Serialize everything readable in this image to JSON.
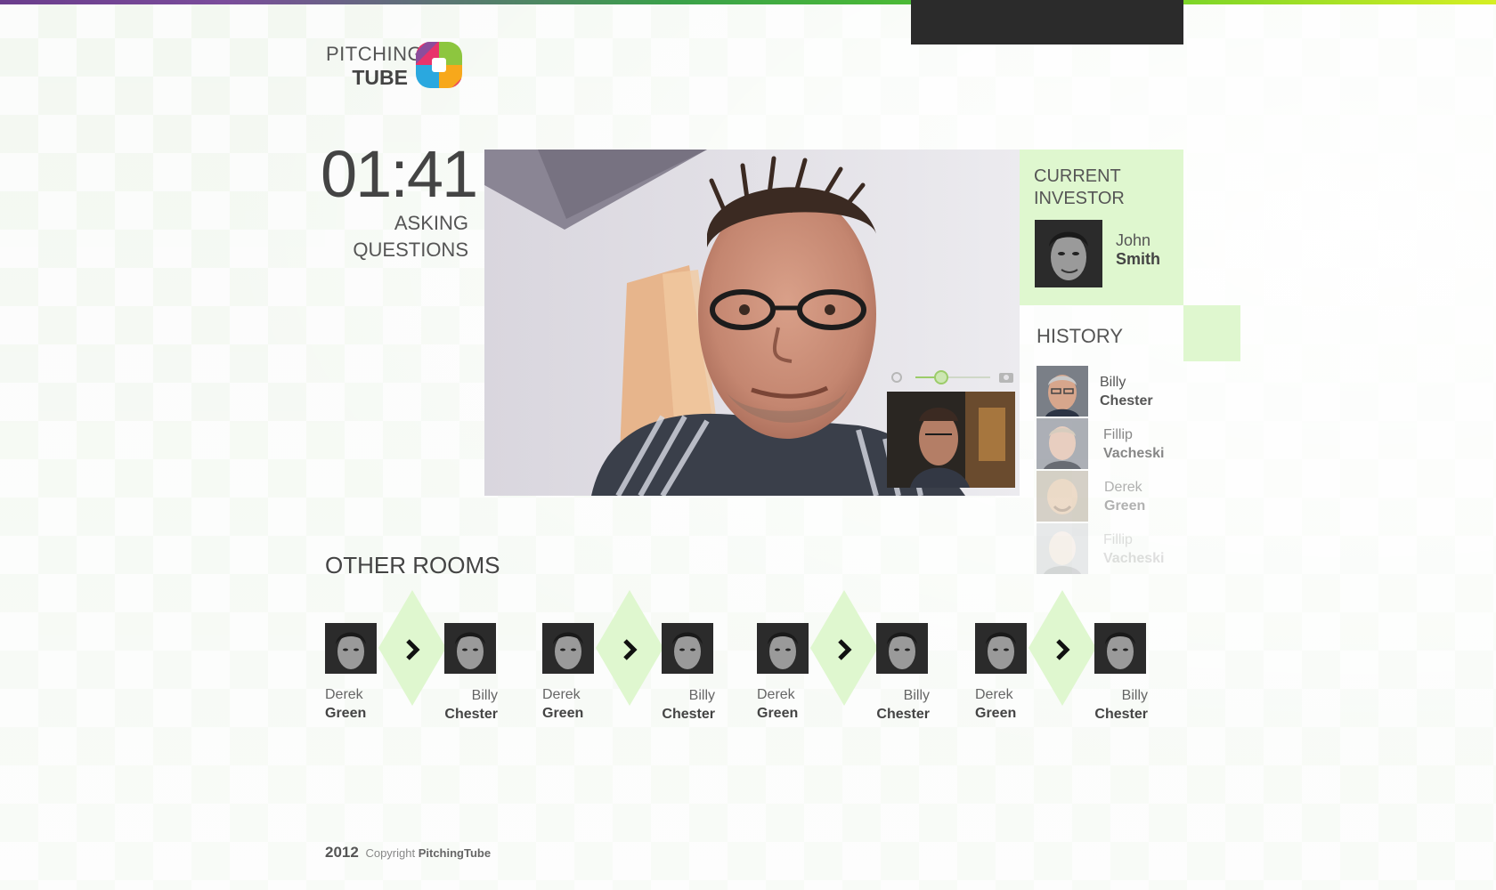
{
  "brand": {
    "logo_line1": "PITCHING",
    "logo_line2": "TUBE",
    "accent_color": "#dff7cf",
    "logo_colors": [
      "#e8336b",
      "#f7a81b",
      "#8dc63f",
      "#2aa8df",
      "#7b52a4"
    ]
  },
  "session": {
    "timer": "01:41",
    "status_line1": "ASKING",
    "status_line2": "QUESTIONS"
  },
  "video": {
    "main_feed": "pitcher-webcam",
    "self_view": "self-webcam",
    "controls": {
      "left_icon": "hand-icon",
      "right_icon": "camera-icon",
      "slider_level": 0.35
    }
  },
  "investor": {
    "title_line1": "CURRENT",
    "title_line2": "INVESTOR",
    "first_name": "John",
    "last_name": "Smith"
  },
  "history": {
    "title": "HISTORY",
    "items": [
      {
        "first": "Billy",
        "last": "Chester"
      },
      {
        "first": "Fillip",
        "last": "Vacheski"
      },
      {
        "first": "Derek",
        "last": "Green"
      },
      {
        "first": "Fillip",
        "last": "Vacheski"
      }
    ]
  },
  "other_rooms": {
    "title": "OTHER ROOMS",
    "rooms": [
      {
        "a_first": "Derek",
        "a_last": "Green",
        "b_first": "Billy",
        "b_last": "Chester"
      },
      {
        "a_first": "Derek",
        "a_last": "Green",
        "b_first": "Billy",
        "b_last": "Chester"
      },
      {
        "a_first": "Derek",
        "a_last": "Green",
        "b_first": "Billy",
        "b_last": "Chester"
      },
      {
        "a_first": "Derek",
        "a_last": "Green",
        "b_first": "Billy",
        "b_last": "Chester"
      }
    ]
  },
  "footer": {
    "year": "2012",
    "copyright": "Copyright",
    "brand": "PitchingTube"
  }
}
